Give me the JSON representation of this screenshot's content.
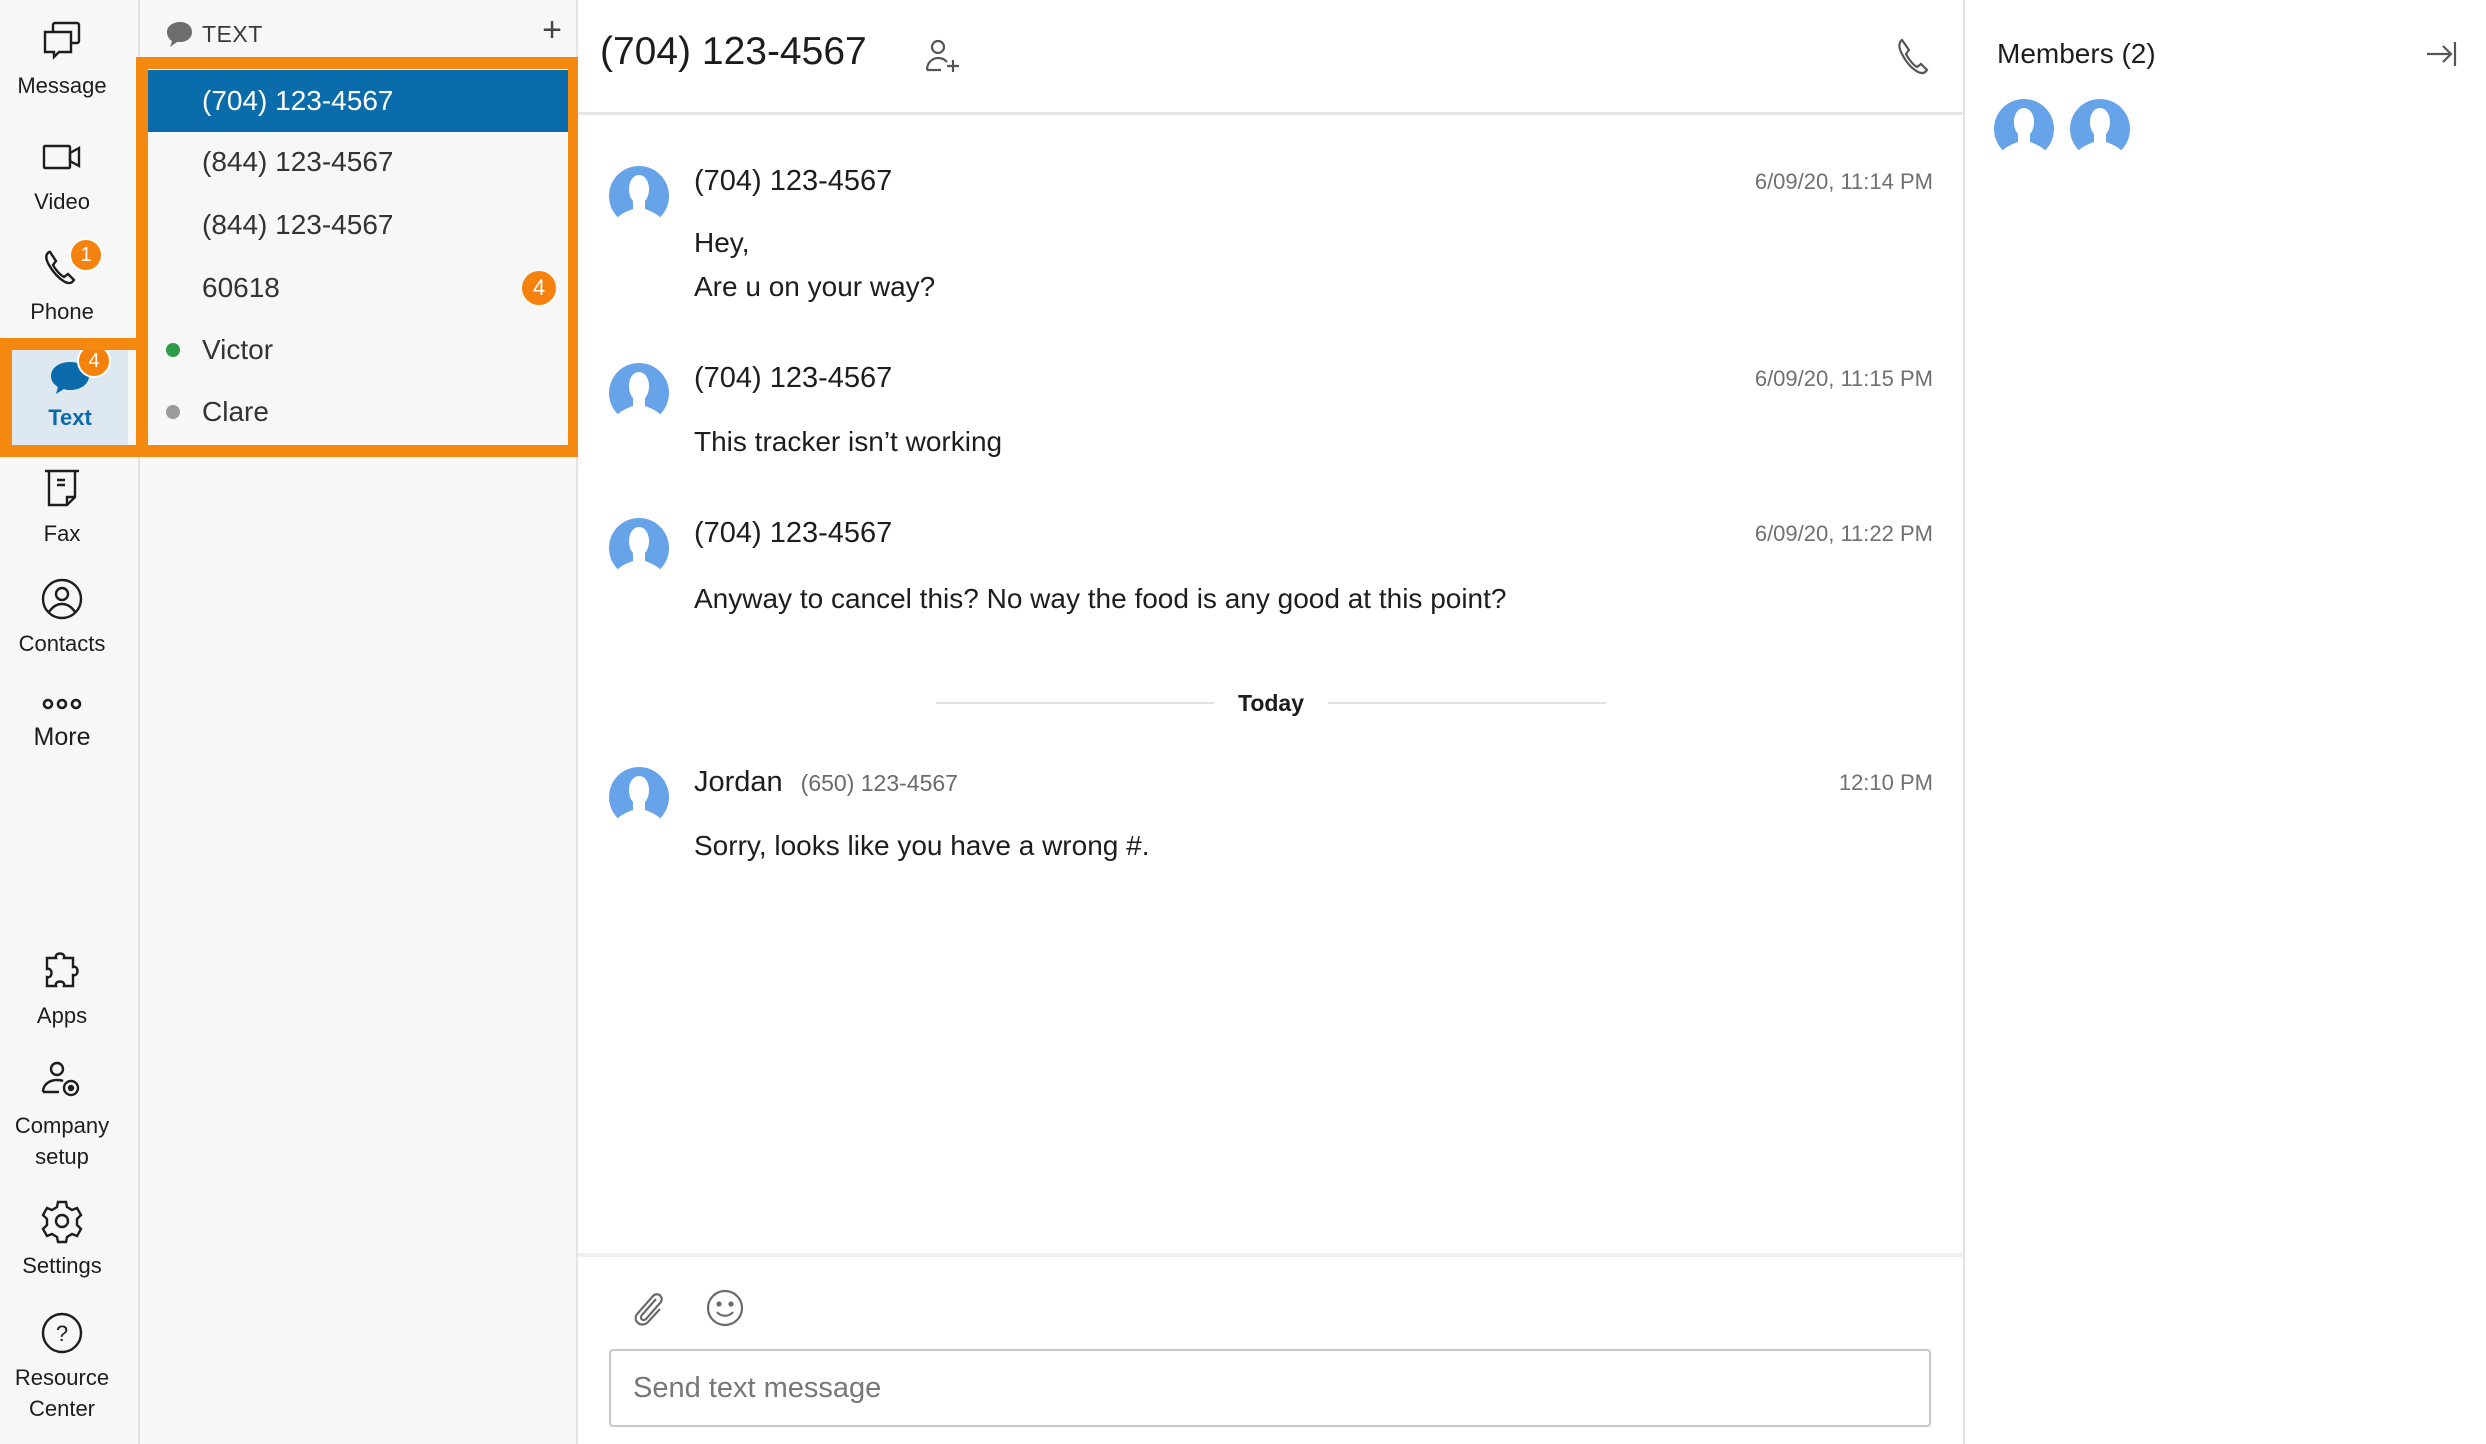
{
  "colors": {
    "accent": "#0a6cab",
    "highlight": "#f5890f",
    "badge": "#f5820d",
    "online": "#2e9b48",
    "offline": "#9a9a9a",
    "avatar": "#66a3e8"
  },
  "nav": {
    "items": [
      {
        "label": "Message",
        "icon": "chat-bubbles-icon"
      },
      {
        "label": "Video",
        "icon": "video-camera-icon"
      },
      {
        "label": "Phone",
        "icon": "phone-icon",
        "badge": "1"
      },
      {
        "label": "Text",
        "icon": "speech-bubble-icon",
        "badge": "4",
        "active": true
      },
      {
        "label": "Fax",
        "icon": "fax-icon"
      },
      {
        "label": "Contacts",
        "icon": "contact-icon"
      },
      {
        "label": "More",
        "icon": "more-dots-icon"
      },
      {
        "label": "Apps",
        "icon": "puzzle-icon"
      },
      {
        "label": "Company setup",
        "icon": "user-gear-icon"
      },
      {
        "label": "Settings",
        "icon": "gear-icon"
      },
      {
        "label": "Resource Center",
        "icon": "help-icon"
      }
    ]
  },
  "list": {
    "header": "TEXT",
    "add_label": "+",
    "conversations": [
      {
        "name": "(704) 123-4567",
        "active": true
      },
      {
        "name": "(844) 123-4567"
      },
      {
        "name": "(844) 123-4567"
      },
      {
        "name": "60618",
        "badge": "4"
      },
      {
        "name": "Victor",
        "status": "online"
      },
      {
        "name": "Clare",
        "status": "offline"
      }
    ]
  },
  "chat": {
    "title": "(704) 123-4567",
    "messages": [
      {
        "sender": "(704) 123-4567",
        "time": "6/09/20, 11:14 PM",
        "lines": [
          "Hey,",
          "Are u on your way?"
        ]
      },
      {
        "sender": "(704) 123-4567",
        "time": "6/09/20, 11:15 PM",
        "lines": [
          "This tracker isn’t working"
        ]
      },
      {
        "sender": "(704) 123-4567",
        "time": "6/09/20, 11:22 PM",
        "lines": [
          "Anyway to cancel this? No way the food is any good at this point?"
        ]
      },
      {
        "sender": "Jordan",
        "sender_number": "(650) 123-4567",
        "time": "12:10 PM",
        "lines": [
          "Sorry, looks like you have a wrong #."
        ]
      }
    ],
    "divider": "Today",
    "composer": {
      "placeholder": "Send text message",
      "value": ""
    }
  },
  "members": {
    "title": "Members (2)",
    "count": 2
  }
}
